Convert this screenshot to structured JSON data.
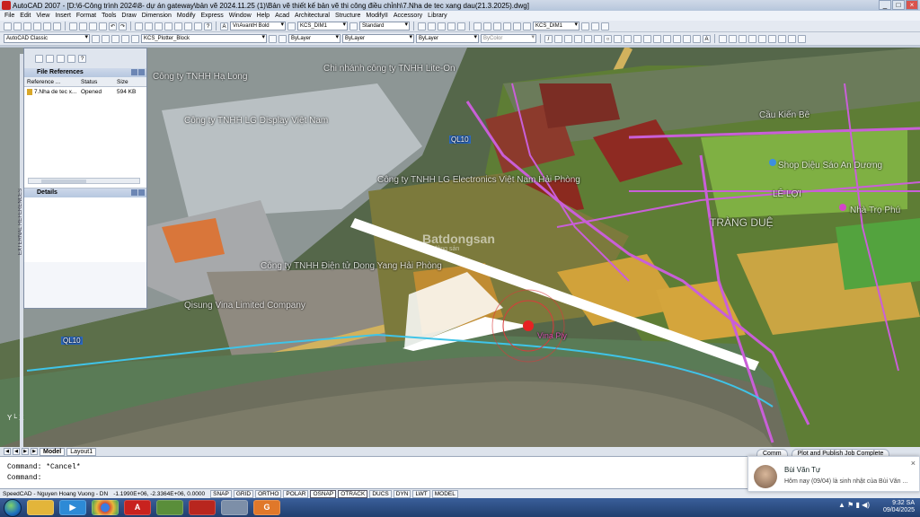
{
  "window": {
    "title": "AutoCAD 2007 - [D:\\6-Công trình 2024\\8- dự án gateway\\bản vẽ 2024.11.25 (1)\\Bản vẽ thiết kế bản vẽ thi công điều chỉnh\\7.Nha de tec xang dau(21.3.2025).dwg]"
  },
  "menu": [
    "File",
    "Edit",
    "View",
    "Insert",
    "Format",
    "Tools",
    "Draw",
    "Dimension",
    "Modify",
    "Express",
    "Window",
    "Help",
    "Acad",
    "Architectural",
    "Structure",
    "ModifyII",
    "Accessory",
    "Library"
  ],
  "toolbar": {
    "text_style": "VnAvantH Bold",
    "dim_style1": "KCS_DIM1",
    "table_style": "Standard",
    "dim_style2": "KCS_DIM1",
    "workspace": "AutoCAD Classic",
    "layer": "KCS_Plotter_Block",
    "color": "ByLayer",
    "linetype": "ByLayer",
    "lineweight": "ByLayer",
    "plotstyle": "ByColor"
  },
  "palette": {
    "title": "File References",
    "columns": [
      "Reference ...",
      "Status",
      "Size"
    ],
    "rows": [
      {
        "name": "7.Nha de tec x...",
        "status": "Opened",
        "size": "594 KB"
      }
    ],
    "details_title": "Details",
    "side_label": "EXTERNAL REFERENCES"
  },
  "map": {
    "labels": [
      "Công ty TNHH LG Display Việt Nam",
      "Công ty TNHH LG Electronics Việt Nam Hải Phòng",
      "Công ty TNHH Điện tử Dong Yang Hải Phòng",
      "Chi nhánh công ty TNHH Lite-On",
      "QL10",
      "QL10",
      "TRÀNG DUỆ",
      "LÊ LỢI",
      "Shop Diệu Sáo An Dương",
      "Nhà Trọ Phú",
      "Qisung Vina Limited Company",
      "Công ty TNHH Hạ Long",
      "Cầu Kiến Bê",
      "Vina Ply"
    ],
    "watermark": "Batdongsan",
    "watermark_sub": "Bất động sản"
  },
  "tabs": [
    "Model",
    "Layout1"
  ],
  "command": {
    "lines": [
      "Command: *Cancel*",
      "Command:"
    ]
  },
  "status": {
    "user": "SpeedCAD - Nguyen Hoang Vuong - DN",
    "coords": "-1.1990E+06, -2.3364E+06, 0.0000",
    "toggles": [
      "SNAP",
      "GRID",
      "ORTHO",
      "POLAR",
      "OSNAP",
      "OTRACK",
      "DUCS",
      "DYN",
      "LWT",
      "MODEL"
    ]
  },
  "notification": {
    "tab1": "Comm",
    "tab2": "Plot and Publish Job Complete",
    "name": "Bùi Văn Tự",
    "message": "Hôm nay (09/04) là sinh nhật của Bùi Văn ..."
  },
  "taskbar": {
    "time": "9:32 SA",
    "date": "09/04/2025"
  }
}
